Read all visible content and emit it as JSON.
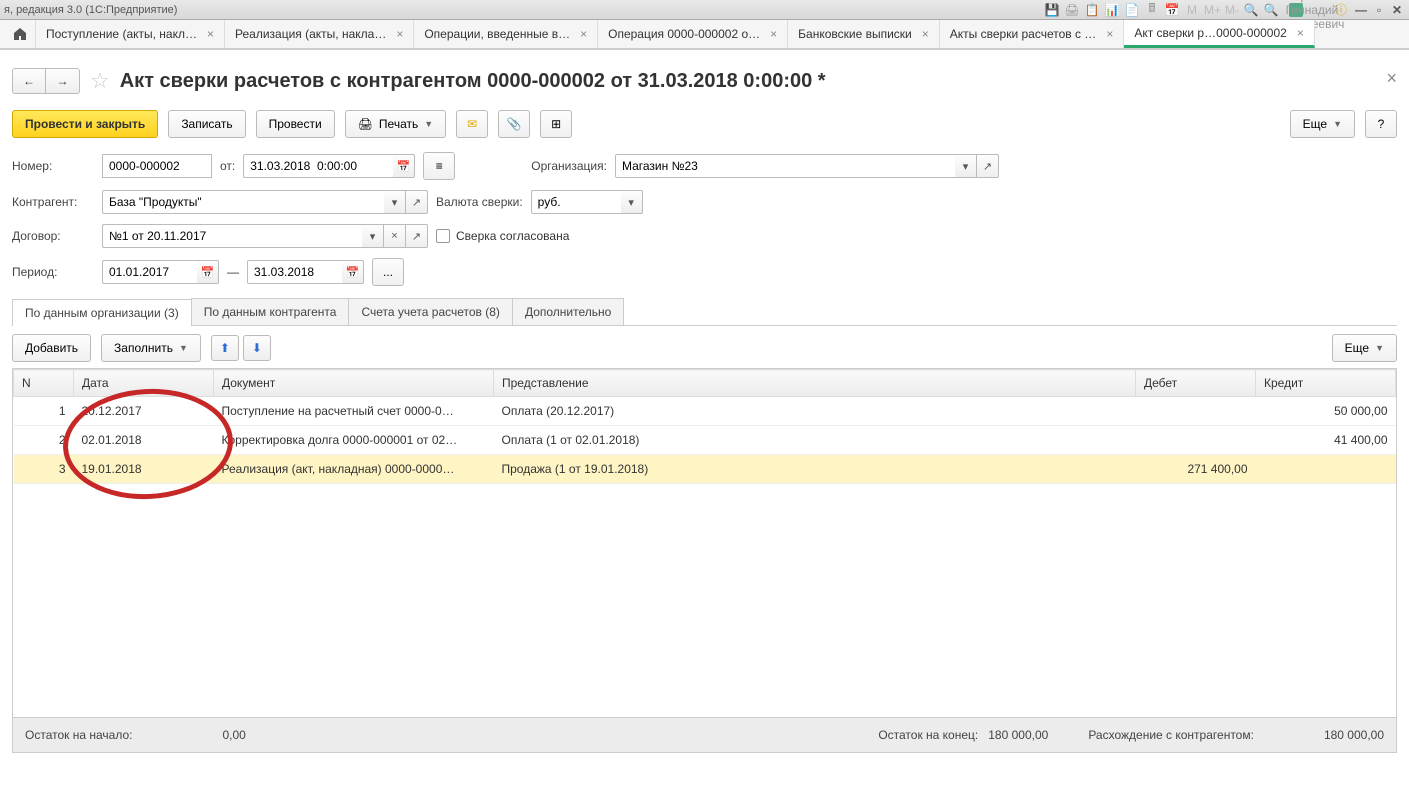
{
  "titlebar": {
    "text": "я, редакция 3.0  (1С:Предприятие)",
    "user": "Абрамов Геннадий Сергеевич",
    "m": "M",
    "mplus": "M+",
    "mminus": "M-"
  },
  "tabs": [
    {
      "label": "Поступление (акты, накл…"
    },
    {
      "label": "Реализация (акты, накла…"
    },
    {
      "label": "Операции, введенные в…"
    },
    {
      "label": "Операция 0000-000002 о…"
    },
    {
      "label": "Банковские выписки"
    },
    {
      "label": "Акты сверки расчетов с …"
    },
    {
      "label": "Акт сверки р…0000-000002"
    }
  ],
  "page": {
    "title": "Акт сверки расчетов с контрагентом 0000-000002 от 31.03.2018 0:00:00 *"
  },
  "toolbar": {
    "post_close": "Провести и закрыть",
    "save": "Записать",
    "post": "Провести",
    "print": "Печать",
    "more": "Еще",
    "help": "?"
  },
  "form": {
    "number_label": "Номер:",
    "number_value": "0000-000002",
    "from_label": "от:",
    "date_value": "31.03.2018  0:00:00",
    "org_label": "Организация:",
    "org_value": "Магазин №23",
    "contractor_label": "Контрагент:",
    "contractor_value": "База \"Продукты\"",
    "currency_label": "Валюта сверки:",
    "currency_value": "руб.",
    "contract_label": "Договор:",
    "contract_value": "№1 от 20.11.2017",
    "reconciled_label": "Сверка согласована",
    "period_label": "Период:",
    "period_from": "01.01.2017",
    "period_sep": "—",
    "period_to": "31.03.2018",
    "period_more": "..."
  },
  "subtabs": [
    {
      "label": "По данным организации (3)"
    },
    {
      "label": "По данным контрагента"
    },
    {
      "label": "Счета учета расчетов (8)"
    },
    {
      "label": "Дополнительно"
    }
  ],
  "table_toolbar": {
    "add": "Добавить",
    "fill": "Заполнить",
    "more": "Еще"
  },
  "table": {
    "headers": {
      "n": "N",
      "date": "Дата",
      "doc": "Документ",
      "repr": "Представление",
      "debit": "Дебет",
      "credit": "Кредит"
    },
    "rows": [
      {
        "n": "1",
        "date": "20.12.2017",
        "doc": "Поступление на расчетный счет 0000-0…",
        "repr": "Оплата (20.12.2017)",
        "debit": "",
        "credit": "50 000,00"
      },
      {
        "n": "2",
        "date": "02.01.2018",
        "doc": "Корректировка долга 0000-000001 от 02…",
        "repr": "Оплата (1 от 02.01.2018)",
        "debit": "",
        "credit": "41 400,00"
      },
      {
        "n": "3",
        "date": "19.01.2018",
        "doc": "Реализация (акт, накладная) 0000-0000…",
        "repr": "Продажа (1 от 19.01.2018)",
        "debit": "271 400,00",
        "credit": ""
      }
    ]
  },
  "footer": {
    "start_label": "Остаток на начало:",
    "start_value": "0,00",
    "end_label": "Остаток на конец:",
    "end_value": "180 000,00",
    "diff_label": "Расхождение с контрагентом:",
    "diff_value": "180 000,00"
  }
}
